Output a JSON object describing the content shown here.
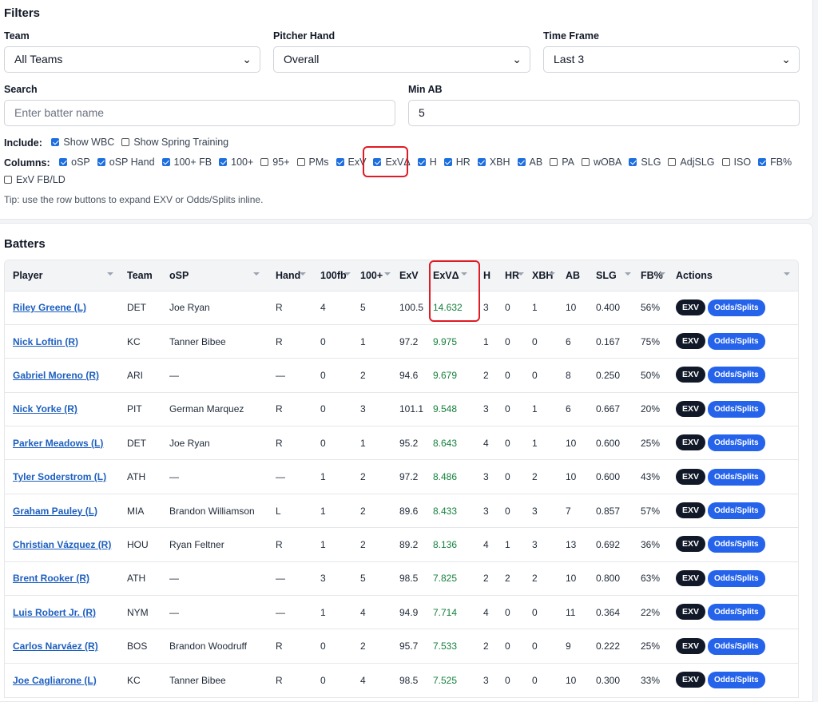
{
  "filters": {
    "title": "Filters",
    "team": {
      "label": "Team",
      "value": "All Teams"
    },
    "pitcher_hand": {
      "label": "Pitcher Hand",
      "value": "Overall"
    },
    "time_frame": {
      "label": "Time Frame",
      "value": "Last 3"
    },
    "search": {
      "label": "Search",
      "placeholder": "Enter batter name"
    },
    "min_ab": {
      "label": "Min AB",
      "value": "5"
    },
    "include": {
      "label": "Include:",
      "options": [
        {
          "label": "Show WBC",
          "checked": true
        },
        {
          "label": "Show Spring Training",
          "checked": false
        }
      ]
    },
    "columns": {
      "label": "Columns:",
      "options": [
        {
          "label": "oSP",
          "checked": true
        },
        {
          "label": "oSP Hand",
          "checked": true
        },
        {
          "label": "100+ FB",
          "checked": true
        },
        {
          "label": "100+",
          "checked": true
        },
        {
          "label": "95+",
          "checked": false
        },
        {
          "label": "PMs",
          "checked": false
        },
        {
          "label": "ExV",
          "checked": true
        },
        {
          "label": "ExVΔ",
          "checked": true
        },
        {
          "label": "H",
          "checked": true
        },
        {
          "label": "HR",
          "checked": true
        },
        {
          "label": "XBH",
          "checked": true
        },
        {
          "label": "AB",
          "checked": true
        },
        {
          "label": "PA",
          "checked": false
        },
        {
          "label": "wOBA",
          "checked": false
        },
        {
          "label": "SLG",
          "checked": true
        },
        {
          "label": "AdjSLG",
          "checked": false
        },
        {
          "label": "ISO",
          "checked": false
        },
        {
          "label": "FB%",
          "checked": true
        },
        {
          "label": "ExV FB/LD",
          "checked": false
        }
      ]
    },
    "tip": "Tip: use the row buttons to expand EXV or Odds/Splits inline."
  },
  "batters": {
    "title": "Batters",
    "columns": [
      "Player",
      "Team",
      "oSP",
      "Hand",
      "100fb",
      "100+",
      "ExV",
      "ExVΔ",
      "H",
      "HR",
      "XBH",
      "AB",
      "SLG",
      "FB%",
      "Actions"
    ],
    "exv_button": "EXV",
    "odds_button": "Odds/Splits",
    "rows": [
      [
        "Riley Greene (L)",
        "DET",
        "Joe Ryan",
        "R",
        "4",
        "5",
        "100.5",
        "14.632",
        "3",
        "0",
        "1",
        "10",
        "0.400",
        "56%"
      ],
      [
        "Nick Loftin (R)",
        "KC",
        "Tanner Bibee",
        "R",
        "0",
        "1",
        "97.2",
        "9.975",
        "1",
        "0",
        "0",
        "6",
        "0.167",
        "75%"
      ],
      [
        "Gabriel Moreno (R)",
        "ARI",
        "—",
        "—",
        "0",
        "2",
        "94.6",
        "9.679",
        "2",
        "0",
        "0",
        "8",
        "0.250",
        "50%"
      ],
      [
        "Nick Yorke (R)",
        "PIT",
        "German Marquez",
        "R",
        "0",
        "3",
        "101.1",
        "9.548",
        "3",
        "0",
        "1",
        "6",
        "0.667",
        "20%"
      ],
      [
        "Parker Meadows (L)",
        "DET",
        "Joe Ryan",
        "R",
        "0",
        "1",
        "95.2",
        "8.643",
        "4",
        "0",
        "1",
        "10",
        "0.600",
        "25%"
      ],
      [
        "Tyler Soderstrom (L)",
        "ATH",
        "—",
        "—",
        "1",
        "2",
        "97.2",
        "8.486",
        "3",
        "0",
        "2",
        "10",
        "0.600",
        "43%"
      ],
      [
        "Graham Pauley (L)",
        "MIA",
        "Brandon Williamson",
        "L",
        "1",
        "2",
        "89.6",
        "8.433",
        "3",
        "0",
        "3",
        "7",
        "0.857",
        "57%"
      ],
      [
        "Christian Vázquez (R)",
        "HOU",
        "Ryan Feltner",
        "R",
        "1",
        "2",
        "89.2",
        "8.136",
        "4",
        "1",
        "3",
        "13",
        "0.692",
        "36%"
      ],
      [
        "Brent Rooker (R)",
        "ATH",
        "—",
        "—",
        "3",
        "5",
        "98.5",
        "7.825",
        "2",
        "2",
        "2",
        "10",
        "0.800",
        "63%"
      ],
      [
        "Luis Robert Jr. (R)",
        "NYM",
        "—",
        "—",
        "1",
        "4",
        "94.9",
        "7.714",
        "4",
        "0",
        "0",
        "11",
        "0.364",
        "22%"
      ],
      [
        "Carlos Narváez (R)",
        "BOS",
        "Brandon Woodruff",
        "R",
        "0",
        "2",
        "95.7",
        "7.533",
        "2",
        "0",
        "0",
        "9",
        "0.222",
        "25%"
      ],
      [
        "Joe Cagliarone (L)",
        "KC",
        "Tanner Bibee",
        "R",
        "0",
        "4",
        "98.5",
        "7.525",
        "3",
        "0",
        "0",
        "10",
        "0.300",
        "33%"
      ]
    ]
  },
  "colors": {
    "accent": "#1d6fe0",
    "link": "#1d5fbf",
    "positive": "#15803d",
    "annotation": "#e01b24",
    "exv_button": "#111827",
    "odds_button": "#2563eb"
  }
}
